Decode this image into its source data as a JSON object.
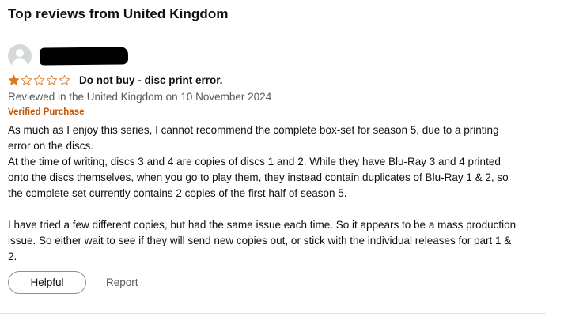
{
  "section_title": "Top reviews from United Kingdom",
  "review": {
    "author": {
      "name_redacted": true
    },
    "rating": {
      "value": 1,
      "max": 5,
      "filled_color": "#de7921",
      "empty_color": "#de7921"
    },
    "title": "Do not buy - disc print error.",
    "meta": "Reviewed in the United Kingdom on 10 November 2024",
    "verified_label": "Verified Purchase",
    "body_lines": [
      "As much as I enjoy this series, I cannot recommend the complete box-set for season 5, due to a printing",
      "error on the discs.",
      "At the time of writing, discs 3 and 4 are copies of discs 1 and 2. While they have Blu-Ray 3 and 4 printed",
      "onto the discs themselves, when you go to play them, they instead contain duplicates of Blu-Ray 1 & 2, so",
      "the complete set currently contains 2 copies of the first half of season 5.",
      "I have tried a few different copies, but had the same issue each time. So it appears to be a mass production",
      "issue. So either wait to see if they will send new copies out, or stick with the individual releases for part 1 &",
      "2."
    ],
    "actions": {
      "helpful_label": "Helpful",
      "report_label": "Report"
    }
  },
  "colors": {
    "verified": "#c45500",
    "meta_text": "#565959",
    "star": "#de7921"
  },
  "icons": {
    "avatar": "default-user-avatar-icon",
    "star_filled": "star-filled-icon",
    "star_empty": "star-empty-icon"
  }
}
